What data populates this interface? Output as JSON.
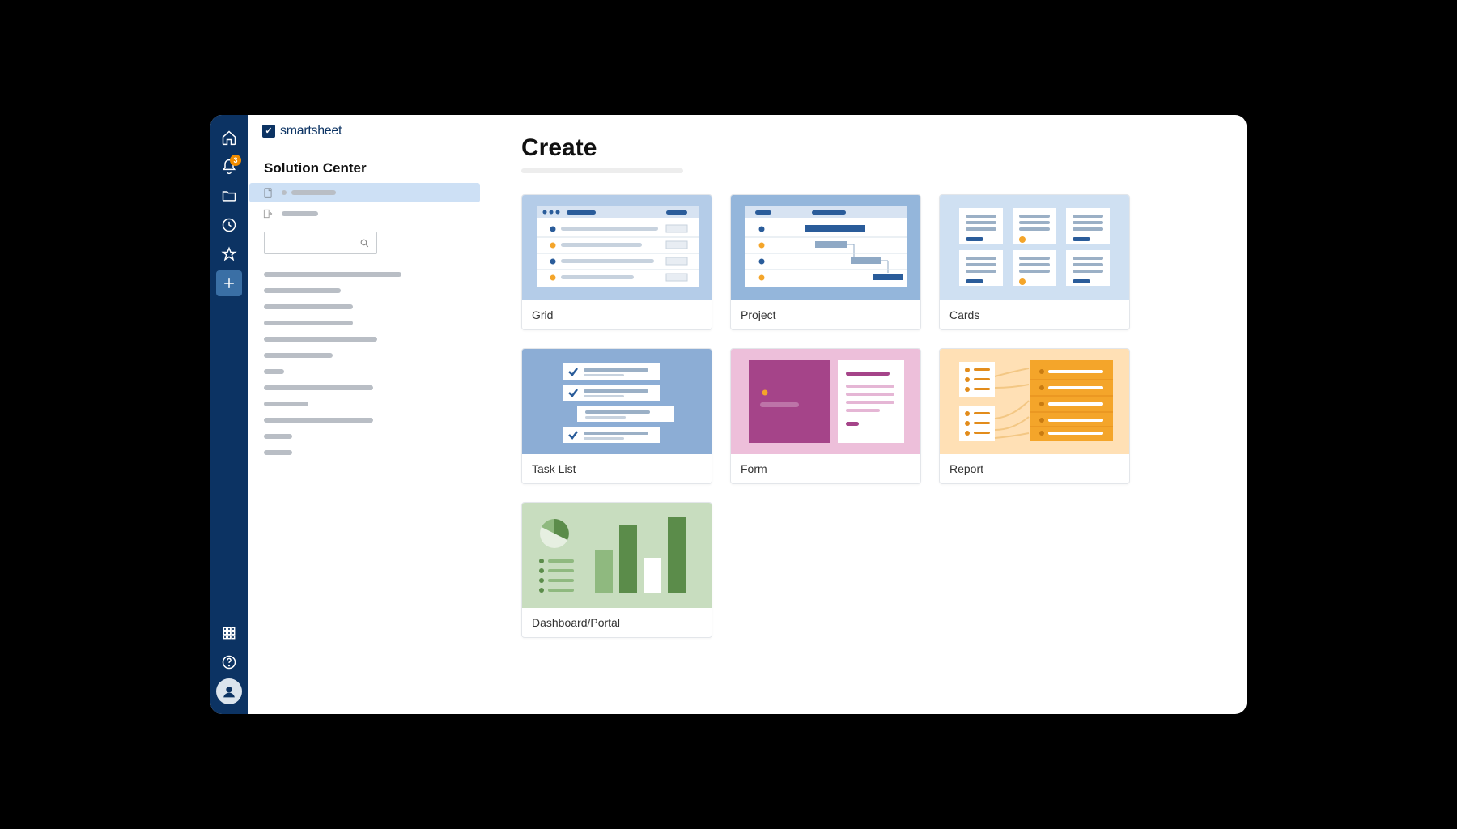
{
  "brand": {
    "name": "smartsheet"
  },
  "rail": {
    "notification_count": "3"
  },
  "sidebar": {
    "title": "Solution Center"
  },
  "main": {
    "title": "Create",
    "cards": [
      {
        "label": "Grid"
      },
      {
        "label": "Project"
      },
      {
        "label": "Cards"
      },
      {
        "label": "Task List"
      },
      {
        "label": "Form"
      },
      {
        "label": "Report"
      },
      {
        "label": "Dashboard/Portal"
      }
    ]
  }
}
